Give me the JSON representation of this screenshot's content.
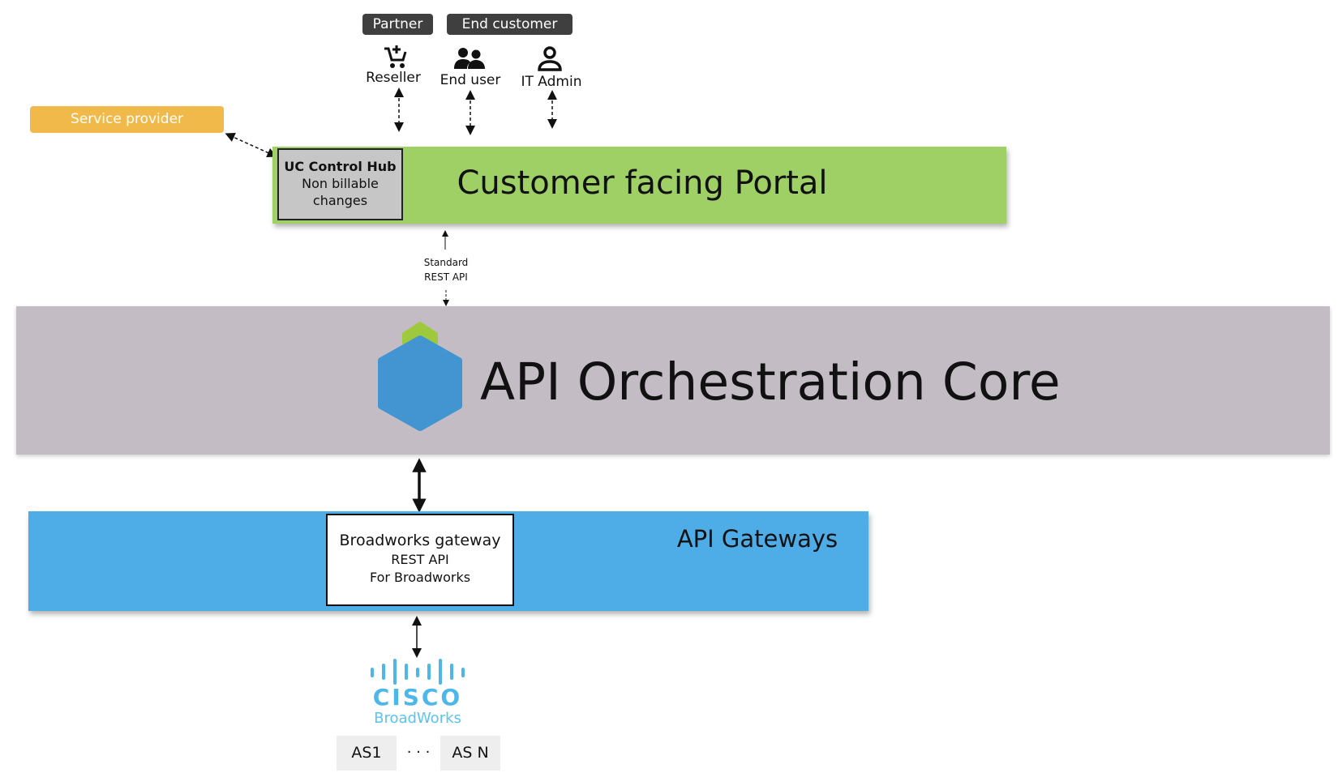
{
  "groups": {
    "partner": "Partner",
    "end_customer": "End customer"
  },
  "roles": [
    {
      "label": "Reseller",
      "icon": "cart-plus-icon"
    },
    {
      "label": "End user",
      "icon": "users-icon"
    },
    {
      "label": "IT Admin",
      "icon": "user-icon"
    }
  ],
  "service_provider": "Service provider",
  "portal": {
    "title": "Customer facing Portal",
    "uc_title": "UC Control Hub",
    "uc_line1": "Non billable",
    "uc_line2": "changes"
  },
  "api_link": {
    "line1": "Standard",
    "line2": "REST API"
  },
  "core": {
    "title": "API Orchestration Core"
  },
  "gateways": {
    "title": "API Gateways",
    "bw_title": "Broadworks gateway",
    "bw_line1": "REST API",
    "bw_line2": "For Broadworks"
  },
  "cisco": {
    "wordmark": "CISCO",
    "product": "BroadWorks"
  },
  "servers": {
    "first": "AS1",
    "dots": "· · ·",
    "last": "AS N"
  },
  "colors": {
    "portal": "#9fd065",
    "core": "#c3bcc5",
    "gateways": "#4eace6",
    "service_provider": "#f0b949",
    "cisco": "#4cb7e8"
  }
}
